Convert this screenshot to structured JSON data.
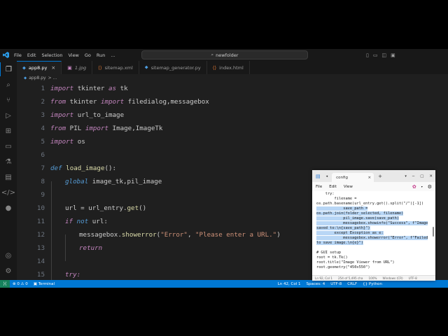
{
  "titlebar": {
    "menus": [
      "File",
      "Edit",
      "Selection",
      "View",
      "Go",
      "Run",
      "..."
    ],
    "search": "newfolder",
    "logo_icon": "vscode-logo-icon"
  },
  "tabs": [
    {
      "label": "app8.py",
      "icon": "python-icon",
      "active": true,
      "color": "#4d9de0"
    },
    {
      "label": "1.jpg",
      "icon": "image-icon",
      "active": false,
      "color": "#c586c0"
    },
    {
      "label": "sitemap.xml",
      "icon": "xml-icon",
      "active": false,
      "color": "#e37933"
    },
    {
      "label": "sitemap_generator.py",
      "icon": "python-icon",
      "active": false,
      "color": "#4d9de0"
    },
    {
      "label": "index.html",
      "icon": "html-icon",
      "active": false,
      "color": "#e37933"
    }
  ],
  "breadcrumb": {
    "file": "app8.py",
    "rest": "> ..."
  },
  "editor": {
    "lines": [
      {
        "n": "1"
      },
      {
        "n": "2"
      },
      {
        "n": "3"
      },
      {
        "n": "4"
      },
      {
        "n": "5"
      },
      {
        "n": "6"
      },
      {
        "n": "7"
      },
      {
        "n": "8"
      },
      {
        "n": "9"
      },
      {
        "n": "10"
      },
      {
        "n": "11"
      },
      {
        "n": "12"
      },
      {
        "n": "13"
      },
      {
        "n": "14"
      },
      {
        "n": "15"
      }
    ],
    "t": {
      "import": "import",
      "from": "from",
      "def": "def",
      "global": "global",
      "if": "if",
      "not": "not",
      "return": "return",
      "try": "try:",
      "l1": " tkinter ",
      "as": "as",
      "tk": " tk",
      "l2a": " tkinter ",
      "l2b": " filedialog,messagebox",
      "l3": " url_to_image",
      "l4a": " PIL ",
      "l4b": " Image,ImageTk",
      "l5": " os",
      "l7fn": "load_image",
      "l7b": "():",
      "l8": " image_tk,pil_image",
      "l10a": "url = url_entry.",
      "l10fn": "get",
      "l10b": "()",
      "l11b": " url:",
      "l12a": "messagebox.",
      "l12fn": "showerror",
      "l12b": "(",
      "l12s1": "\"Error\"",
      "l12c": ", ",
      "l12s2": "\"Please enter a URL.\"",
      "l12d": ")"
    }
  },
  "statusbar": {
    "errors": "⊗ 0 ⚠ 0",
    "terminal": "Terminal",
    "position": "Ln 42, Col 1",
    "spaces": "Spaces: 4",
    "encoding": "UTF-8",
    "eol": "CRLF",
    "language": "Python"
  },
  "notepad": {
    "tab_title": "config",
    "menus": [
      "File",
      "Edit",
      "View"
    ],
    "lines": [
      {
        "text": "    try:",
        "sel": false
      },
      {
        "text": "        filename =",
        "sel": false
      },
      {
        "text": "os.path.basename(url_entry.get().split(\"/\")[-1])",
        "sel": false
      },
      {
        "text": "            save_path =",
        "sel": true
      },
      {
        "text": "os.path.join(folder_selected, filename)",
        "sel": true
      },
      {
        "text": "            pil_image.save(save_path)",
        "sel": true
      },
      {
        "text": "            messagebox.showinfo(\"Success\", f\"Image",
        "sel": true
      },
      {
        "text": "saved to:\\n{save_path}\")",
        "sel": true
      },
      {
        "text": "        except Exception as e:",
        "sel": true
      },
      {
        "text": "            messagebox.showerror(\"Error\", f\"Failed",
        "sel": true
      },
      {
        "text": "to save image.\\n{e}\")",
        "sel": true
      },
      {
        "text": "",
        "sel": false
      },
      {
        "text": "# GUI setup",
        "sel": false
      },
      {
        "text": "root = tk.Tk()",
        "sel": false
      },
      {
        "text": "root.title(\"Image Viewer from URL\")",
        "sel": false
      },
      {
        "text": "root.geometry(\"450x550\")",
        "sel": false
      }
    ],
    "status": {
      "pos": "Ln 92, Col 1",
      "chars": "254 of 5,495 cha",
      "zoom": "100%",
      "eol": "Windows (CR)",
      "encoding": "UTF-8"
    }
  }
}
